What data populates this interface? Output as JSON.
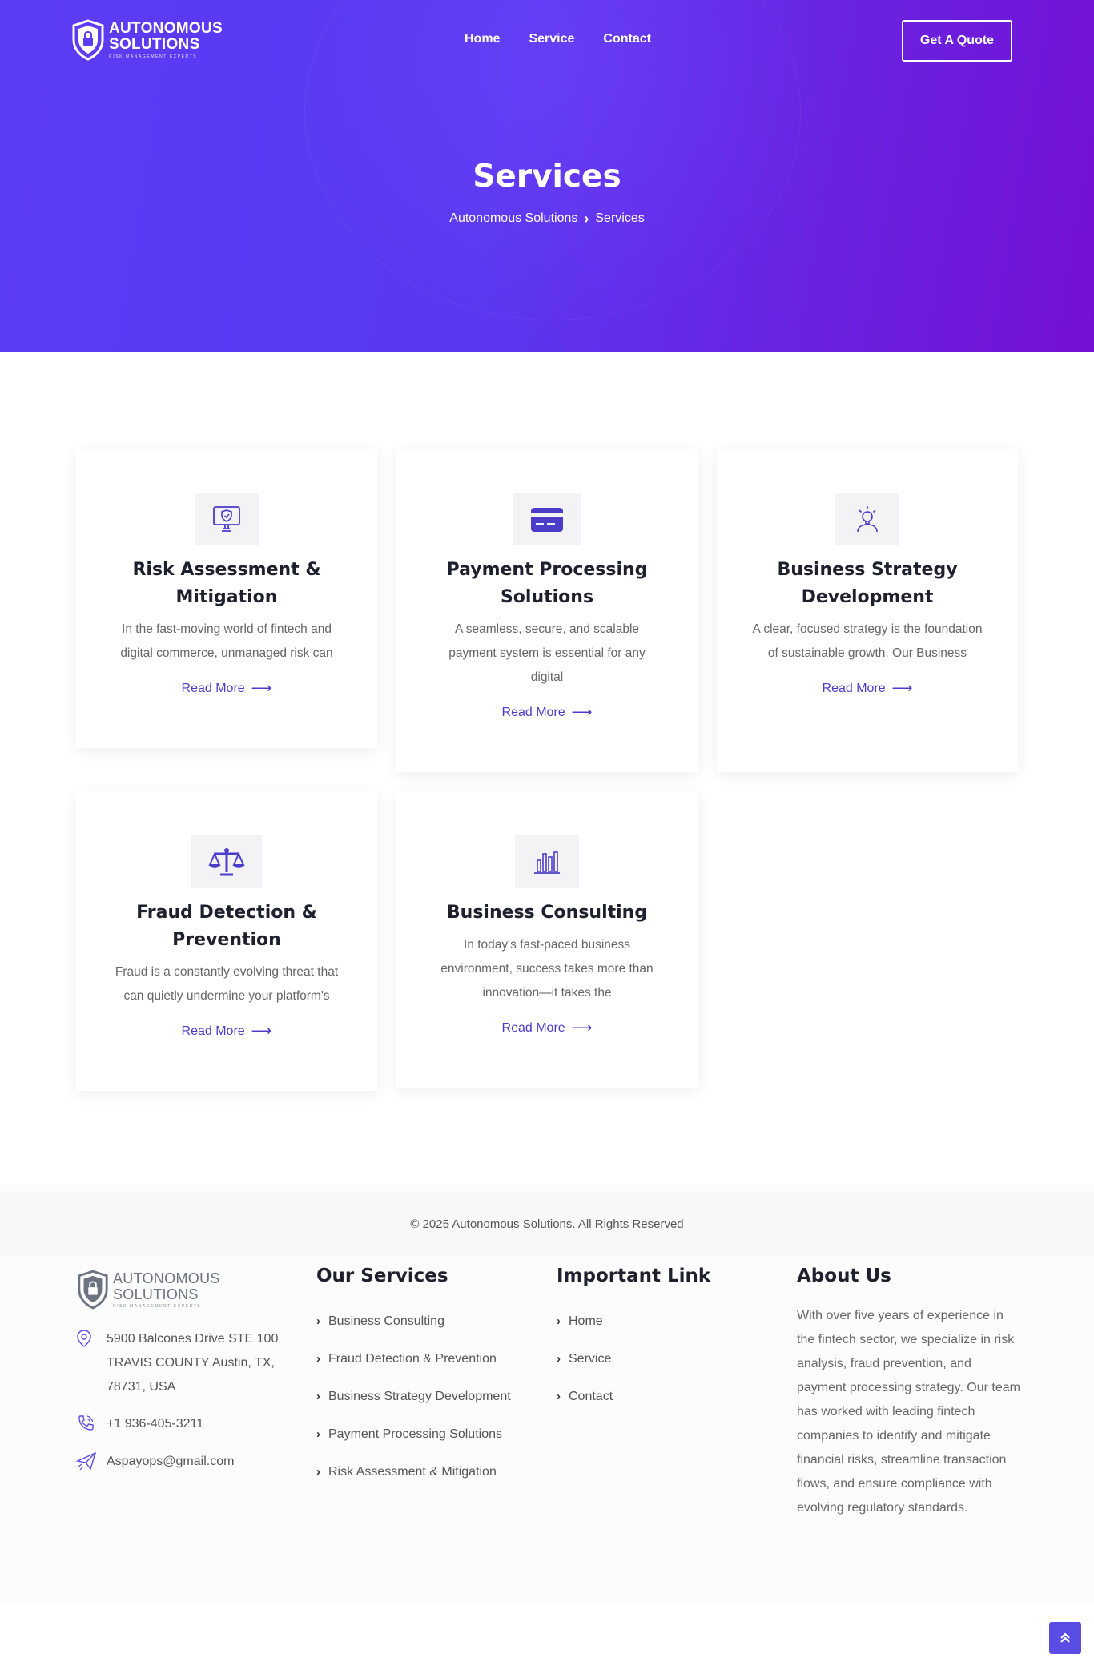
{
  "brand": {
    "name_line1": "AUTONOMOUS",
    "name_line2": "SOLUTIONS",
    "tagline": "RISK MANAGEMENT EXPERTS",
    "primary_color": "#5a3cf4",
    "accent_color": "#4b3cc9"
  },
  "nav": {
    "links": [
      "Home",
      "Service",
      "Contact"
    ],
    "cta": "Get A Quote"
  },
  "hero": {
    "title": "Services",
    "breadcrumb": [
      "Autonomous Solutions",
      "Services"
    ]
  },
  "services": [
    {
      "icon": "monitor-shield-icon",
      "title": "Risk Assessment & Mitigation",
      "description": "In the fast-moving world of fintech and digital commerce, unmanaged risk can",
      "link": "Read More"
    },
    {
      "icon": "credit-card-icon",
      "title": "Payment Processing Solutions",
      "description": "A seamless, secure, and scalable payment system is essential for any digital",
      "link": "Read More"
    },
    {
      "icon": "lightbulb-person-icon",
      "title": "Business Strategy Development",
      "description": "A clear, focused strategy is the foundation of sustainable growth. Our Business",
      "link": "Read More"
    },
    {
      "icon": "balance-scale-icon",
      "title": "Fraud Detection & Prevention",
      "description": "Fraud is a constantly evolving threat that can quietly undermine your platform's",
      "link": "Read More"
    },
    {
      "icon": "bar-chart-icon",
      "title": "Business Consulting",
      "description": "In today's fast-paced business environment, success takes more than innovation—it takes the",
      "link": "Read More"
    }
  ],
  "footer": {
    "address": "5900 Balcones Drive STE 100 TRAVIS COUNTY Austin, TX, 78731, USA",
    "phone": "+1 936-405-3211",
    "email": "Aspayops@gmail.com",
    "services_heading": "Our Services",
    "services_links": [
      "Business Consulting",
      "Fraud Detection & Prevention",
      "Business Strategy Development",
      "Payment Processing Solutions",
      "Risk Assessment & Mitigation"
    ],
    "important_heading": "Important Link",
    "important_links": [
      "Home",
      "Service",
      "Contact"
    ],
    "about_heading": "About Us",
    "about_text": "With over five years of experience in the fintech sector, we specialize in risk analysis, fraud prevention, and payment processing strategy. Our team has worked with leading fintech companies to identify and mitigate financial risks, streamline transaction flows, and ensure compliance with evolving regulatory standards.",
    "copyright": "© 2025 Autonomous Solutions. All Rights Reserved"
  }
}
